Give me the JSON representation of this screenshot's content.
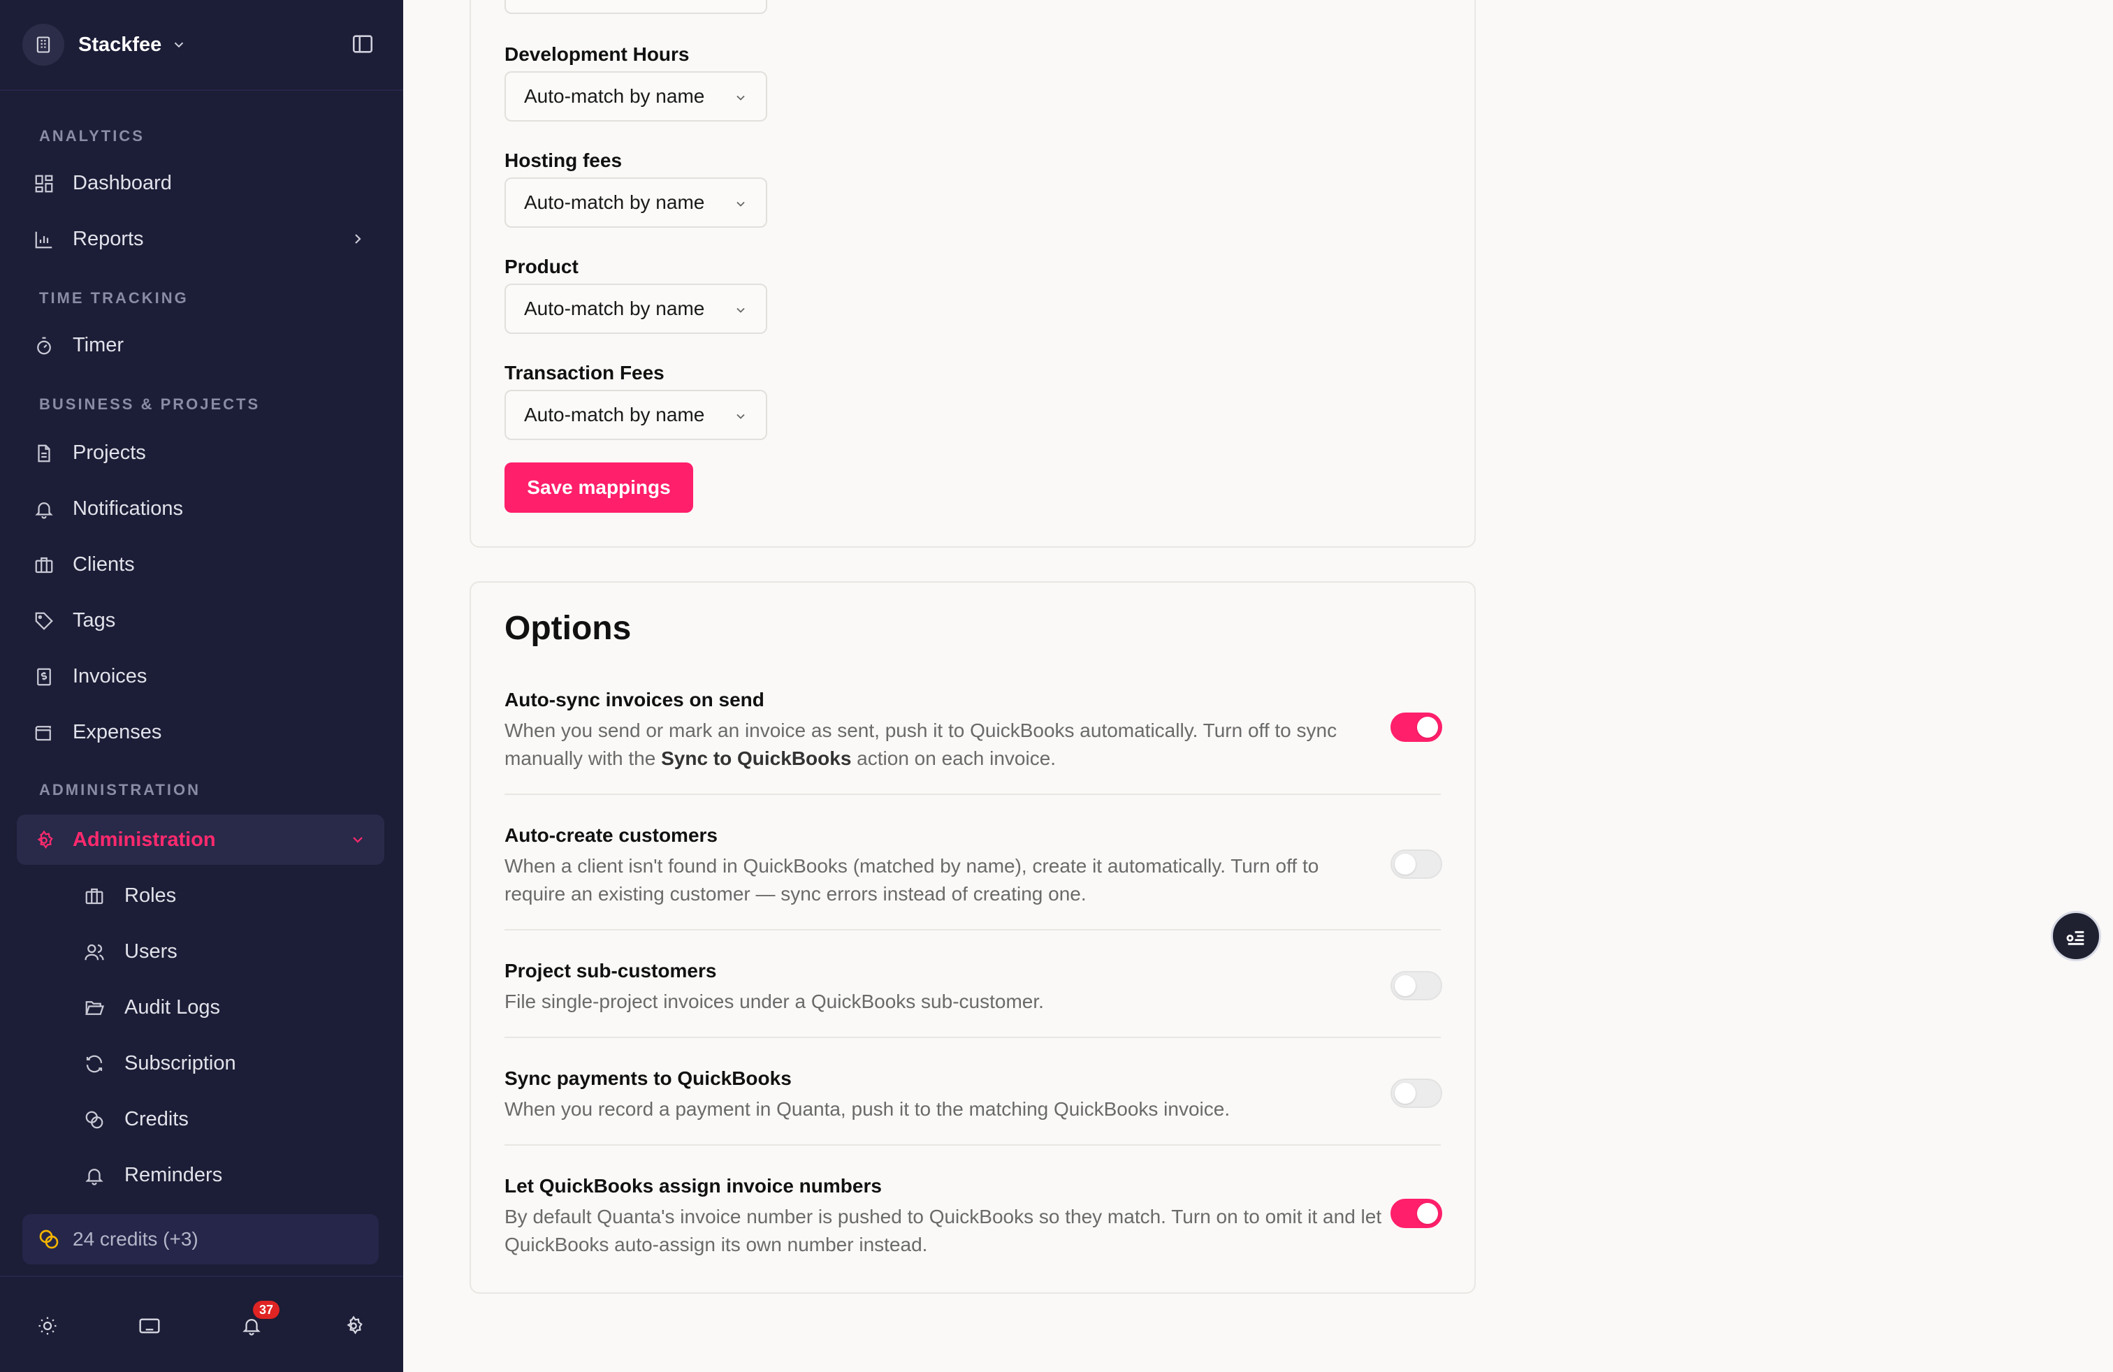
{
  "workspace": {
    "name": "Stackfee"
  },
  "sidebar": {
    "sections": {
      "analytics": "ANALYTICS",
      "time_tracking": "TIME TRACKING",
      "business_projects": "BUSINESS & PROJECTS",
      "administration": "ADMINISTRATION"
    },
    "items": {
      "dashboard": "Dashboard",
      "reports": "Reports",
      "timer": "Timer",
      "projects": "Projects",
      "notifications": "Notifications",
      "clients": "Clients",
      "tags": "Tags",
      "invoices": "Invoices",
      "expenses": "Expenses",
      "administration": "Administration",
      "roles": "Roles",
      "users": "Users",
      "audit_logs": "Audit Logs",
      "subscription": "Subscription",
      "credits": "Credits",
      "reminders": "Reminders"
    },
    "credits_badge": "24 credits (+3)",
    "notification_count": "37"
  },
  "mappings": {
    "fields": [
      {
        "label": "Development Hours",
        "value": "Auto-match by name"
      },
      {
        "label": "Hosting fees",
        "value": "Auto-match by name"
      },
      {
        "label": "Product",
        "value": "Auto-match by name"
      },
      {
        "label": "Transaction Fees",
        "value": "Auto-match by name"
      }
    ],
    "save_label": "Save mappings"
  },
  "options": {
    "title": "Options",
    "items": [
      {
        "title": "Auto-sync invoices on send",
        "desc_before": "When you send or mark an invoice as sent, push it to QuickBooks automatically. Turn off to sync manually with the ",
        "desc_bold": "Sync to QuickBooks",
        "desc_after": " action on each invoice.",
        "enabled": true
      },
      {
        "title": "Auto-create customers",
        "desc": "When a client isn't found in QuickBooks (matched by name), create it automatically. Turn off to require an existing customer — sync errors instead of creating one.",
        "enabled": false
      },
      {
        "title": "Project sub-customers",
        "desc": "File single-project invoices under a QuickBooks sub-customer.",
        "enabled": false
      },
      {
        "title": "Sync payments to QuickBooks",
        "desc": "When you record a payment in Quanta, push it to the matching QuickBooks invoice.",
        "enabled": false
      },
      {
        "title": "Let QuickBooks assign invoice numbers",
        "desc": "By default Quanta's invoice number is pushed to QuickBooks so they match. Turn on to omit it and let QuickBooks auto-assign its own number instead.",
        "enabled": true
      }
    ]
  },
  "colors": {
    "accent": "#ff1f6b",
    "sidebar_bg": "#1c1d36"
  }
}
